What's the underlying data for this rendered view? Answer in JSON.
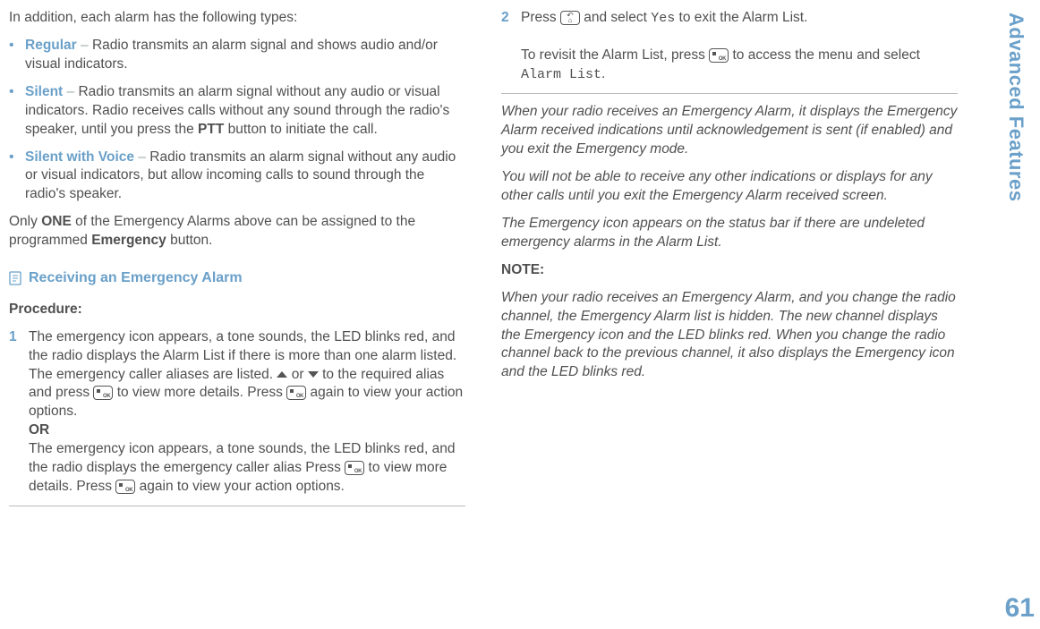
{
  "sidebar": {
    "section": "Advanced Features",
    "page": "61"
  },
  "left": {
    "intro": "In addition, each alarm has the following types:",
    "types": [
      {
        "name": "Regular",
        "desc": "Radio transmits an alarm signal and shows audio and/or visual indicators."
      },
      {
        "name": "Silent",
        "desc_a": "Radio transmits an alarm signal without any audio or visual indicators. Radio receives calls without any sound through the radio's speaker, until you press the ",
        "ptt": "PTT",
        "desc_b": " button to initiate the call."
      },
      {
        "name": "Silent with Voice",
        "desc": "Radio transmits an alarm signal without any audio or visual indicators, but allow incoming calls to sound through the radio's speaker."
      }
    ],
    "only_a": "Only ",
    "only_one": "ONE",
    "only_b": " of the Emergency Alarms above can be assigned to the programmed ",
    "only_emerg": "Emergency",
    "only_c": " button.",
    "subheading": "Receiving an Emergency Alarm",
    "procedure_label": "Procedure:",
    "step1_a": "The emergency icon appears, a tone sounds, the LED blinks red, and the radio displays the Alarm List if there is more than one alarm listed. The emergency caller aliases are listed. ",
    "step1_b": " or ",
    "step1_c": " to the required alias and press ",
    "step1_d": " to view more details. Press ",
    "step1_e": " again to view your action options.",
    "or": "OR",
    "step1_f": "The emergency icon appears, a tone sounds, the LED blinks red, and the radio displays the emergency caller alias Press ",
    "step1_g": " to view more details. Press ",
    "step1_h": " again to view your action options."
  },
  "right": {
    "step2_a": "Press ",
    "step2_b": " and select ",
    "step2_yes": "Yes",
    "step2_c": " to exit the Alarm List.",
    "step2_d": "To revisit the Alarm List, press ",
    "step2_e": " to access the menu and select ",
    "step2_alarmlist": "Alarm List",
    "step2_f": ".",
    "note1": "When your radio receives an Emergency Alarm, it displays the Emergency Alarm received indications until acknowledgement is sent (if enabled) and you exit the Emergency mode.",
    "note2": "You will not be able to receive any other indications or displays for any other calls until you exit the Emergency Alarm received screen.",
    "note3": "The Emergency icon appears on the status bar if there are undeleted emergency alarms in the Alarm List.",
    "note_label": "NOTE:",
    "note4": "When your radio receives an Emergency Alarm, and you change the radio channel, the Emergency Alarm list is hidden. The new channel displays the Emergency icon and the LED blinks red. When you change the radio channel back to the previous channel, it also displays the Emergency icon and the LED blinks red."
  }
}
